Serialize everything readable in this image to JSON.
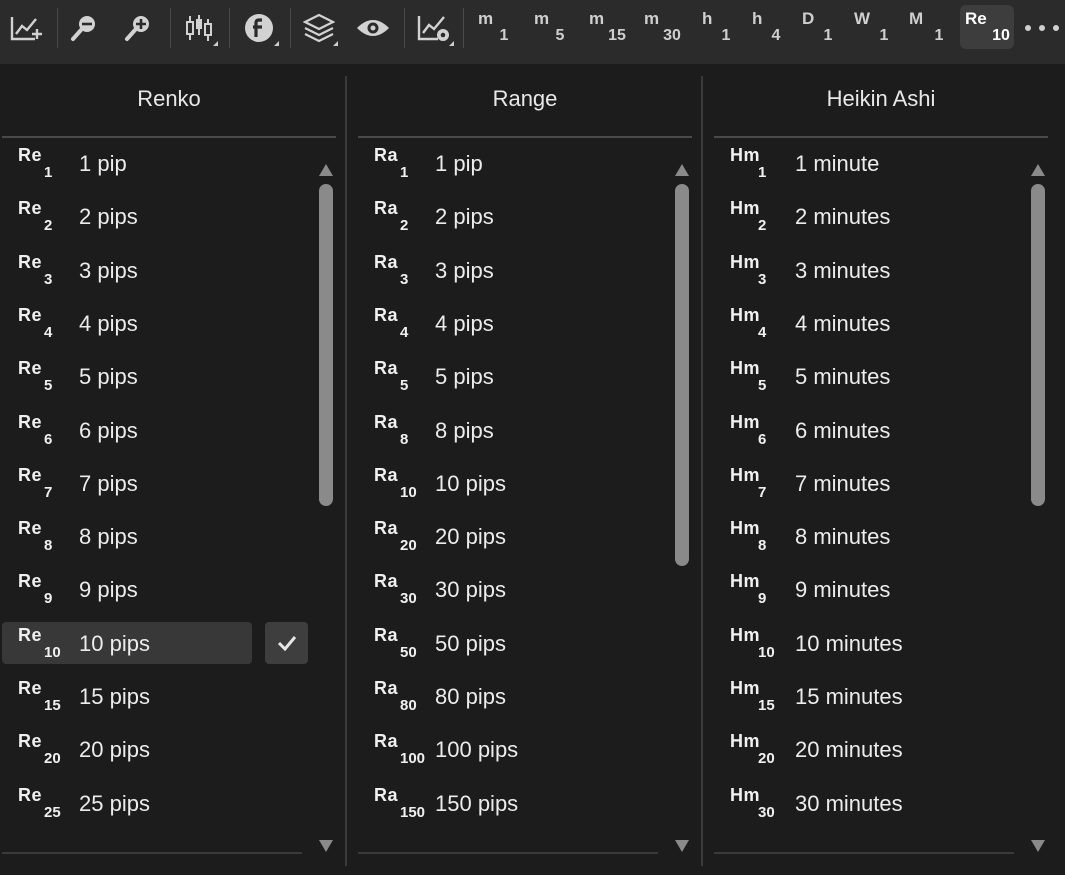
{
  "toolbar": {
    "icons": [
      "chart-add-icon",
      "zoom-out-icon",
      "zoom-in-icon",
      "candlestick-icon",
      "f-icon",
      "layers-icon",
      "eye-icon",
      "chart-settings-icon",
      "more-icon"
    ],
    "timeframes": [
      {
        "main": "m",
        "sub": "1"
      },
      {
        "main": "m",
        "sub": "5"
      },
      {
        "main": "m",
        "sub": "15"
      },
      {
        "main": "m",
        "sub": "30"
      },
      {
        "main": "h",
        "sub": "1"
      },
      {
        "main": "h",
        "sub": "4"
      },
      {
        "main": "D",
        "sub": "1"
      },
      {
        "main": "W",
        "sub": "1"
      },
      {
        "main": "M",
        "sub": "1"
      },
      {
        "main": "Re",
        "sub": "10"
      }
    ],
    "active_timeframe": "Re10"
  },
  "columns": [
    {
      "title": "Renko",
      "items": [
        {
          "abbr": "Re",
          "sub": "1",
          "label": "1 pip"
        },
        {
          "abbr": "Re",
          "sub": "2",
          "label": "2 pips"
        },
        {
          "abbr": "Re",
          "sub": "3",
          "label": "3 pips"
        },
        {
          "abbr": "Re",
          "sub": "4",
          "label": "4 pips"
        },
        {
          "abbr": "Re",
          "sub": "5",
          "label": "5 pips"
        },
        {
          "abbr": "Re",
          "sub": "6",
          "label": "6 pips"
        },
        {
          "abbr": "Re",
          "sub": "7",
          "label": "7 pips"
        },
        {
          "abbr": "Re",
          "sub": "8",
          "label": "8 pips"
        },
        {
          "abbr": "Re",
          "sub": "9",
          "label": "9 pips"
        },
        {
          "abbr": "Re",
          "sub": "10",
          "label": "10 pips",
          "selected": true
        },
        {
          "abbr": "Re",
          "sub": "15",
          "label": "15 pips"
        },
        {
          "abbr": "Re",
          "sub": "20",
          "label": "20 pips"
        },
        {
          "abbr": "Re",
          "sub": "25",
          "label": "25 pips"
        }
      ]
    },
    {
      "title": "Range",
      "items": [
        {
          "abbr": "Ra",
          "sub": "1",
          "label": "1 pip"
        },
        {
          "abbr": "Ra",
          "sub": "2",
          "label": "2 pips"
        },
        {
          "abbr": "Ra",
          "sub": "3",
          "label": "3 pips"
        },
        {
          "abbr": "Ra",
          "sub": "4",
          "label": "4 pips"
        },
        {
          "abbr": "Ra",
          "sub": "5",
          "label": "5 pips"
        },
        {
          "abbr": "Ra",
          "sub": "8",
          "label": "8 pips"
        },
        {
          "abbr": "Ra",
          "sub": "10",
          "label": "10 pips"
        },
        {
          "abbr": "Ra",
          "sub": "20",
          "label": "20 pips"
        },
        {
          "abbr": "Ra",
          "sub": "30",
          "label": "30 pips"
        },
        {
          "abbr": "Ra",
          "sub": "50",
          "label": "50 pips"
        },
        {
          "abbr": "Ra",
          "sub": "80",
          "label": "80 pips"
        },
        {
          "abbr": "Ra",
          "sub": "100",
          "label": "100 pips"
        },
        {
          "abbr": "Ra",
          "sub": "150",
          "label": "150 pips"
        }
      ]
    },
    {
      "title": "Heikin Ashi",
      "items": [
        {
          "abbr": "Hm",
          "sub": "1",
          "label": "1 minute"
        },
        {
          "abbr": "Hm",
          "sub": "2",
          "label": "2 minutes"
        },
        {
          "abbr": "Hm",
          "sub": "3",
          "label": "3 minutes"
        },
        {
          "abbr": "Hm",
          "sub": "4",
          "label": "4 minutes"
        },
        {
          "abbr": "Hm",
          "sub": "5",
          "label": "5 minutes"
        },
        {
          "abbr": "Hm",
          "sub": "6",
          "label": "6 minutes"
        },
        {
          "abbr": "Hm",
          "sub": "7",
          "label": "7 minutes"
        },
        {
          "abbr": "Hm",
          "sub": "8",
          "label": "8 minutes"
        },
        {
          "abbr": "Hm",
          "sub": "9",
          "label": "9 minutes"
        },
        {
          "abbr": "Hm",
          "sub": "10",
          "label": "10 minutes"
        },
        {
          "abbr": "Hm",
          "sub": "15",
          "label": "15 minutes"
        },
        {
          "abbr": "Hm",
          "sub": "20",
          "label": "20 minutes"
        },
        {
          "abbr": "Hm",
          "sub": "30",
          "label": "30 minutes"
        }
      ]
    }
  ],
  "colors": {
    "background": "#1c1c1c",
    "toolbar": "#2b2b2b",
    "selected_row": "#383838",
    "scrollbar": "#8a8a8a"
  }
}
